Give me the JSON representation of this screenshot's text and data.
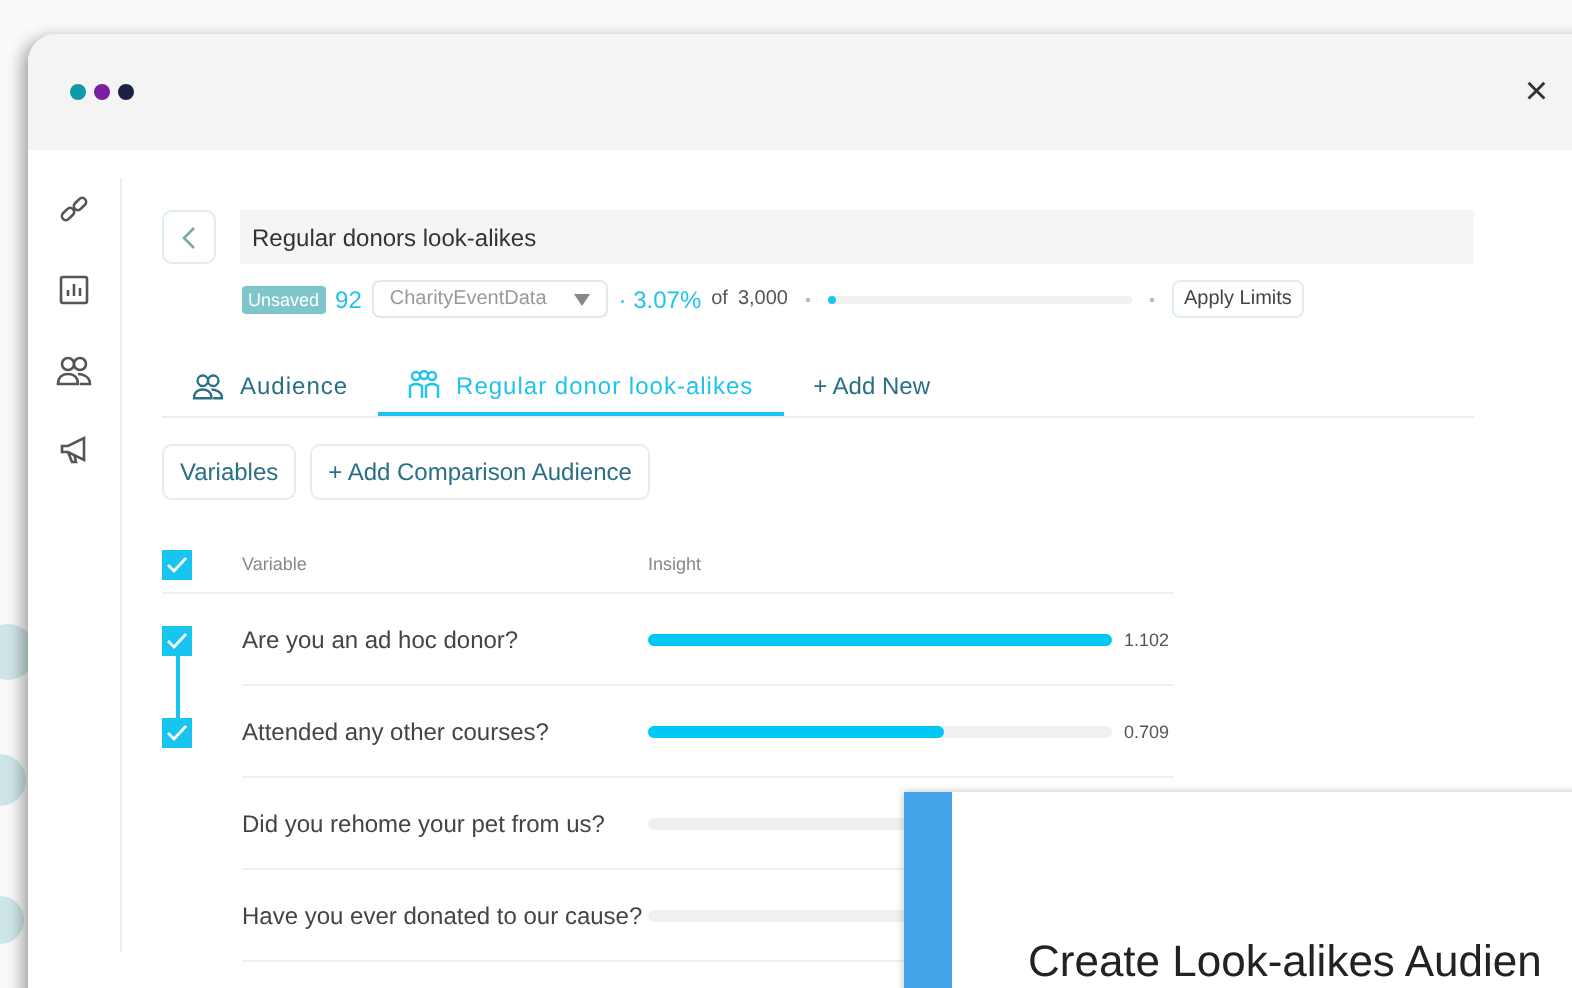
{
  "window": {
    "dots": [
      {
        "color": "#0e9aa7"
      },
      {
        "color": "#7a1fa2"
      },
      {
        "color": "#1c2143"
      }
    ],
    "close": "×"
  },
  "header": {
    "name": "Regular donors look-alikes",
    "status": "Unsaved",
    "count": "92",
    "dataset": "CharityEventData",
    "percent": "· 3.07%",
    "of": "of",
    "total": "3,000",
    "limit": {
      "level": 0.02
    },
    "apply": "Apply Limits"
  },
  "tabs": [
    {
      "label": "Audience",
      "selected": false
    },
    {
      "label": "Regular donor look-alikes",
      "selected": true
    }
  ],
  "add_tab": "+ Add New",
  "buttons": [
    "Variables",
    "+ Add Comparison Audience"
  ],
  "table": {
    "all_checked": true,
    "columns": [
      "Variable",
      "Insight"
    ],
    "rows": [
      {
        "checked": true,
        "label": "Are you an ad hoc donor?",
        "level": 1.0,
        "value": "1.102"
      },
      {
        "checked": true,
        "label": "Attended any other courses?",
        "level": 0.64,
        "value": "0.709"
      },
      {
        "checked": false,
        "label": "Did you rehome your pet from us?"
      },
      {
        "checked": false,
        "label": "Have you ever donated to our cause?"
      }
    ]
  },
  "dialog": {
    "title": "Create Look-alikes Audien"
  }
}
